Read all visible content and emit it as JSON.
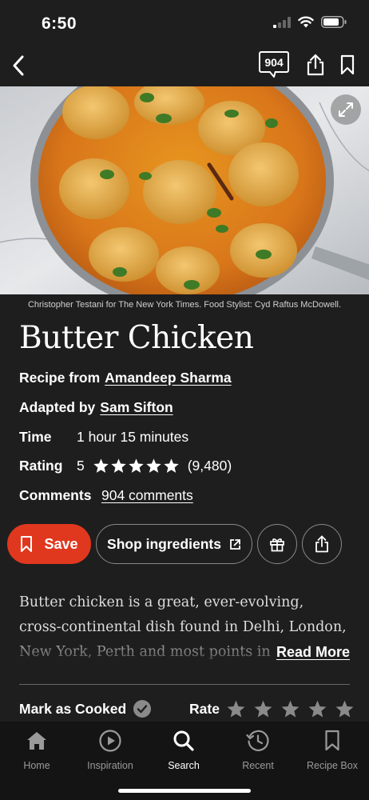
{
  "status_bar": {
    "time": "6:50"
  },
  "nav": {
    "comment_count": "904"
  },
  "hero": {
    "caption": "Christopher Testani for The New York Times. Food Stylist: Cyd Raftus McDowell."
  },
  "recipe": {
    "title": "Butter Chicken",
    "recipe_from_label": "Recipe from",
    "recipe_from_name": "Amandeep Sharma",
    "adapted_by_label": "Adapted by",
    "adapted_by_name": "Sam Sifton",
    "time_label": "Time",
    "time_value": "1 hour 15 minutes",
    "rating_label": "Rating",
    "rating_value": "5",
    "rating_stars": 5,
    "rating_count": "(9,480)",
    "comments_label": "Comments",
    "comments_link": "904 comments"
  },
  "actions": {
    "save_label": "Save",
    "shop_label": "Shop ingredients"
  },
  "description": {
    "text": "Butter chicken is a great, ever-evolving, cross-continental dish found in Delhi, London, New York, Perth and most points in between.",
    "read_more": "Read More"
  },
  "cook": {
    "mark_cooked_label": "Mark as Cooked",
    "rate_label": "Rate",
    "rate_stars_total": 5
  },
  "tabs": [
    {
      "label": "Home",
      "icon": "home-icon"
    },
    {
      "label": "Inspiration",
      "icon": "play-circle-icon"
    },
    {
      "label": "Search",
      "icon": "search-icon",
      "active": true
    },
    {
      "label": "Recent",
      "icon": "history-icon"
    },
    {
      "label": "Recipe Box",
      "icon": "bookmark-icon"
    }
  ],
  "colors": {
    "background": "#1e1e1e",
    "accent": "#e0381f",
    "tab_bar": "#141414"
  }
}
